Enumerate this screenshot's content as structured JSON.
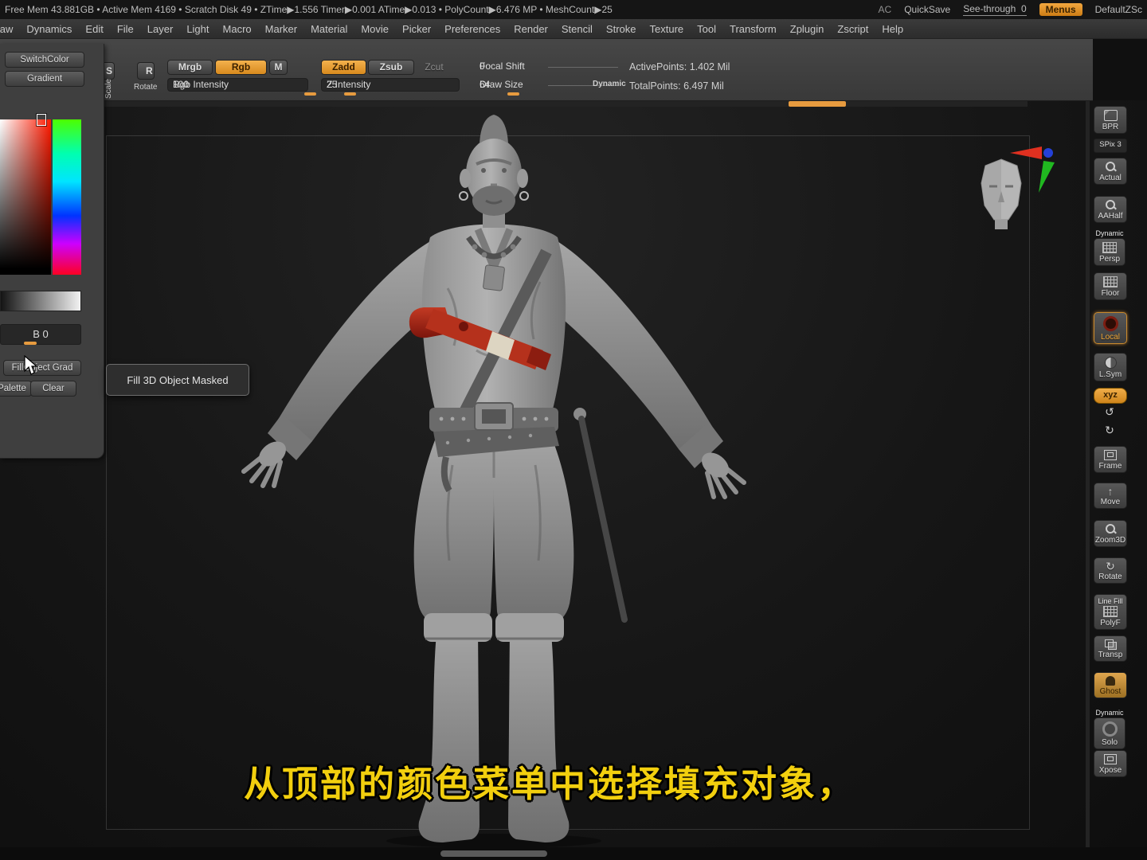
{
  "statusbar": {
    "info": "Free Mem 43.881GB • Active Mem 4169 • Scratch Disk 49 • ZTime▶1.556 Timer▶0.001 ATime▶0.013 • PolyCount▶6.476 MP • MeshCount▶25",
    "ac": "AC",
    "quicksave": "QuickSave",
    "seethrough_label": "See-through",
    "seethrough_value": "0",
    "menus": "Menus",
    "config": "DefaultZSc"
  },
  "menubar": {
    "items": [
      "Draw",
      "Dynamics",
      "Edit",
      "File",
      "Layer",
      "Light",
      "Macro",
      "Marker",
      "Material",
      "Movie",
      "Picker",
      "Preferences",
      "Render",
      "Stencil",
      "Stroke",
      "Texture",
      "Tool",
      "Transform",
      "Zplugin",
      "Zscript",
      "Help"
    ]
  },
  "toolbar": {
    "scale_letter": "S",
    "scale": "Scale",
    "rotate_letter": "R",
    "rotate": "Rotate",
    "mrgb": "Mrgb",
    "rgb": "Rgb",
    "m": "M",
    "rgb_intensity_label": "Rgb Intensity",
    "rgb_intensity_value": "100",
    "zadd": "Zadd",
    "zsub": "Zsub",
    "zcut": "Zcut",
    "z_intensity_label": "Z Intensity",
    "z_intensity_value": "25",
    "focal_shift_label": "Focal Shift",
    "focal_shift_value": "0",
    "draw_size_label": "Draw Size",
    "draw_size_value": "64",
    "dynamic": "Dynamic",
    "active_points": "ActivePoints: 1.402 Mil",
    "total_points": "TotalPoints: 6.497 Mil"
  },
  "color_panel": {
    "switch_color": "SwitchColor",
    "gradient": "Gradient",
    "b_label": "B 0",
    "fill_object": "FillObject Grad",
    "palette": "Palette",
    "clear": "Clear"
  },
  "tooltip": "Fill 3D Object Masked",
  "right_toolbar": {
    "bpr": "BPR",
    "spix": "SPix 3",
    "actual": "Actual",
    "aahalf": "AAHalf",
    "persp_top": "Dynamic",
    "persp": "Persp",
    "floor": "Floor",
    "local": "Local",
    "lsym": "L.Sym",
    "xyz": "xyz",
    "frame": "Frame",
    "move": "Move",
    "zoom3d": "Zoom3D",
    "rotate": "Rotate",
    "linefill_top": "Line Fill",
    "polyf": "PolyF",
    "transp": "Transp",
    "ghost": "Ghost",
    "solo_top": "Dynamic",
    "solo": "Solo",
    "xpose": "Xpose"
  },
  "subtitle": "从顶部的颜色菜单中选择填充对象，",
  "colors": {
    "accent_orange": "#e79b3f",
    "subtitle_yellow": "#f2cf0e",
    "canvas_bg": "#161616"
  }
}
